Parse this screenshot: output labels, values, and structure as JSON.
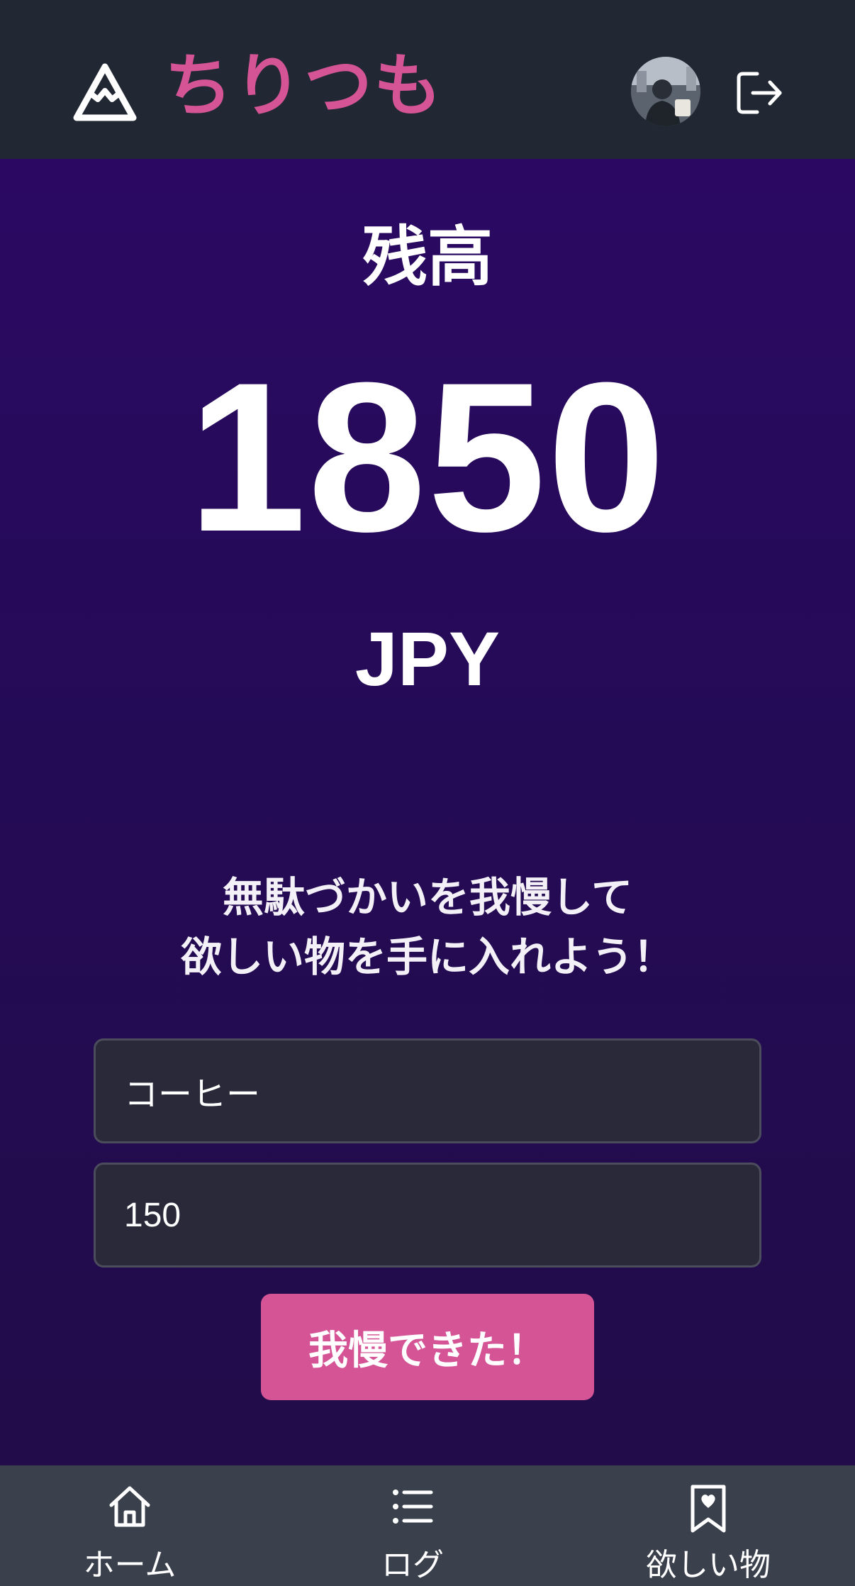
{
  "header": {
    "app_title": "ちりつも",
    "logo_icon": "mountain-icon",
    "avatar_alt": "user avatar",
    "logout_icon": "logout-icon"
  },
  "balance": {
    "label": "残高",
    "amount": "1850",
    "currency": "JPY"
  },
  "message": {
    "line1": "無駄づかいを我慢して",
    "line2": "欲しい物を手に入れよう！"
  },
  "form": {
    "item_value": "コーヒー",
    "amount_value": "150",
    "submit_label": "我慢できた！"
  },
  "bottom_nav": {
    "items": [
      {
        "label": "ホーム",
        "icon": "home-icon"
      },
      {
        "label": "ログ",
        "icon": "list-icon"
      },
      {
        "label": "欲しい物",
        "icon": "bookmark-heart-icon"
      }
    ]
  },
  "colors": {
    "brand_pink": "#d55496",
    "header_bg": "#212833",
    "main_bg": "#240b5a",
    "nav_bg": "#3a404c",
    "input_bg": "#292939"
  }
}
